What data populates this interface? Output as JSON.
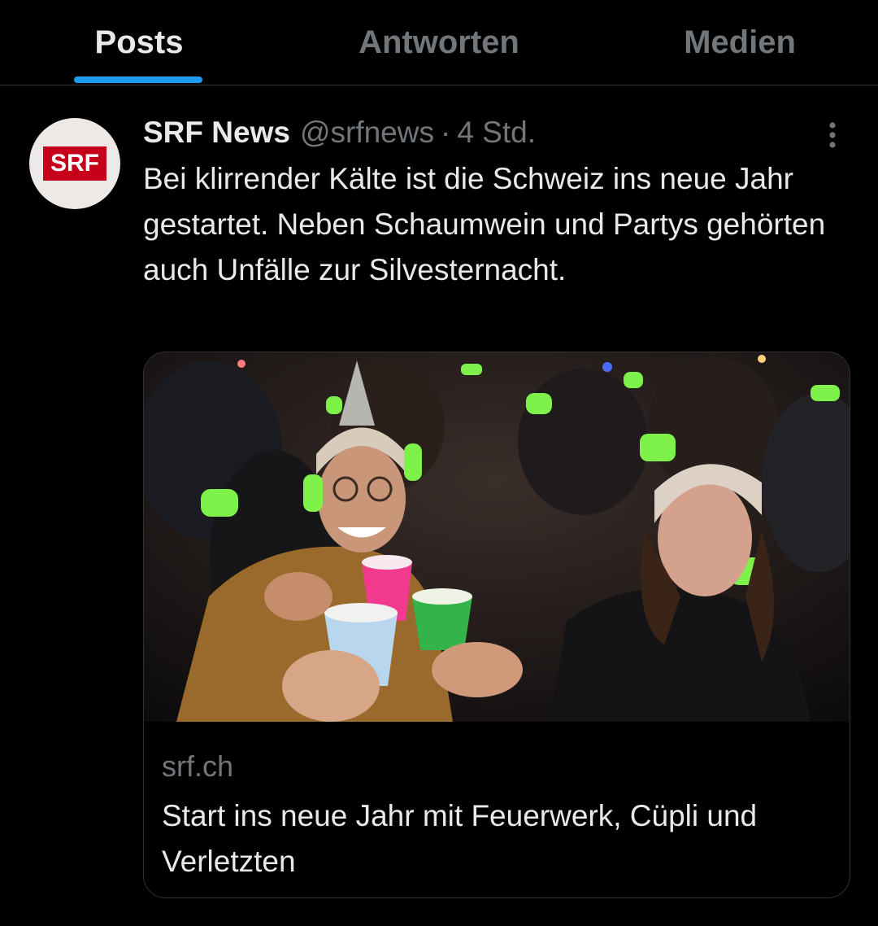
{
  "tabs": [
    {
      "label": "Posts",
      "active": true
    },
    {
      "label": "Antworten",
      "active": false
    },
    {
      "label": "Medien",
      "active": false
    }
  ],
  "post": {
    "avatar_text": "SRF",
    "author_name": "SRF News",
    "author_handle": "@srfnews",
    "separator": "·",
    "time": "4 Std.",
    "text": "Bei klirrender Kälte ist die Schweiz ins neue Jahr gestartet. Neben Schaumwein und Partys gehörten auch Unfälle zur Silvesternacht.",
    "card": {
      "domain": "srf.ch",
      "title": "Start ins neue Jahr mit Feuerwerk, Cüpli und Verletzten"
    }
  },
  "colors": {
    "accent": "#1d9bf0",
    "brand_red": "#c4001a",
    "background": "#000000",
    "text_primary": "#e7e9ea",
    "text_secondary": "#71767b",
    "border": "#2f3336"
  },
  "icons": {
    "more": "more-vertical-icon"
  }
}
